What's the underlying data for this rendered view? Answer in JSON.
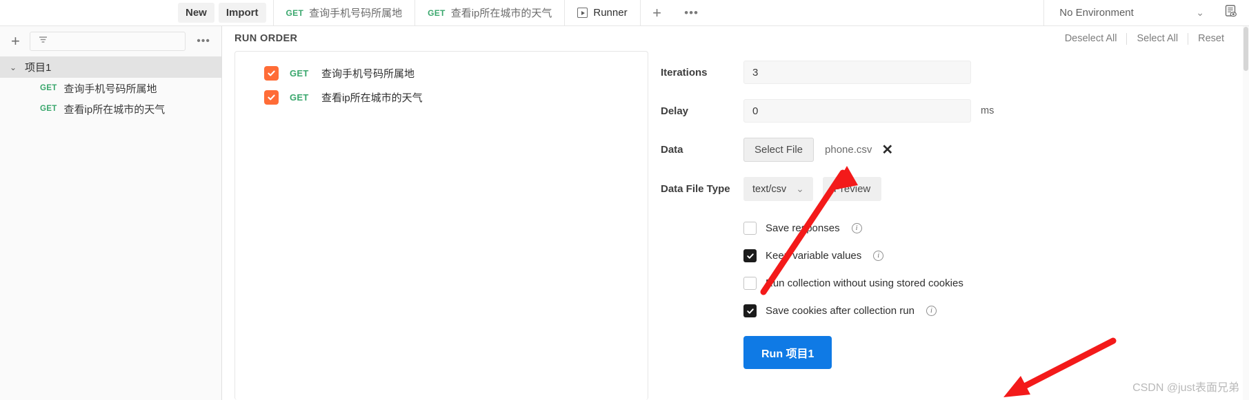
{
  "topbar": {
    "new_label": "New",
    "import_label": "Import",
    "tabs": [
      {
        "verb": "GET",
        "label": "查询手机号码所属地",
        "active": false,
        "icon": ""
      },
      {
        "verb": "GET",
        "label": "查看ip所在城市的天气",
        "active": false,
        "icon": ""
      },
      {
        "verb": "",
        "label": "Runner",
        "active": true,
        "icon": "play-icon"
      }
    ],
    "add_tab_glyph": "+",
    "more_tabs_glyph": "•••",
    "environment": "No Environment",
    "environment_chevron": "⌄",
    "env_quicklook_icon": "environment-quicklook-icon"
  },
  "sidebar": {
    "add_glyph": "+",
    "filter_icon": "filter-icon",
    "more_glyph": "•••",
    "collection": {
      "caret": "⌄",
      "name": "项目1"
    },
    "requests": [
      {
        "verb": "GET",
        "label": "查询手机号码所属地"
      },
      {
        "verb": "GET",
        "label": "查看ip所在城市的天气"
      }
    ]
  },
  "runner": {
    "run_order_title": "RUN ORDER",
    "actions": [
      {
        "label": "Deselect All"
      },
      {
        "label": "Select All"
      },
      {
        "label": "Reset"
      }
    ],
    "order_items": [
      {
        "checked": true,
        "verb": "GET",
        "label": "查询手机号码所属地"
      },
      {
        "checked": true,
        "verb": "GET",
        "label": "查看ip所在城市的天气"
      }
    ],
    "settings": {
      "iterations_label": "Iterations",
      "iterations_value": "3",
      "delay_label": "Delay",
      "delay_value": "0",
      "delay_unit": "ms",
      "data_label": "Data",
      "select_file_label": "Select File",
      "file_name": "phone.csv",
      "remove_file_glyph": "✕",
      "data_file_type_label": "Data File Type",
      "data_file_type_value": "text/csv",
      "data_file_type_chevron": "⌄",
      "preview_label": "Preview",
      "options": [
        {
          "label": "Save responses",
          "checked": false,
          "info": true
        },
        {
          "label": "Keep variable values",
          "checked": true,
          "info": true
        },
        {
          "label": "Run collection without using stored cookies",
          "checked": false,
          "info": false
        },
        {
          "label": "Save cookies after collection run",
          "checked": true,
          "info": true
        }
      ],
      "run_button_label": "Run 项目1"
    }
  },
  "annotations": {
    "watermark": "CSDN @just表面兄弟",
    "arrow_color": "#f31a1a",
    "arrows": [
      {
        "name": "arrow-to-select-file"
      },
      {
        "name": "arrow-to-run-button"
      }
    ]
  },
  "colors": {
    "postman_orange": "#ff6c37",
    "method_get_green": "#3aa76d",
    "run_button_blue": "#0f7ae5",
    "checkbox_dark": "#1b1b1b"
  }
}
